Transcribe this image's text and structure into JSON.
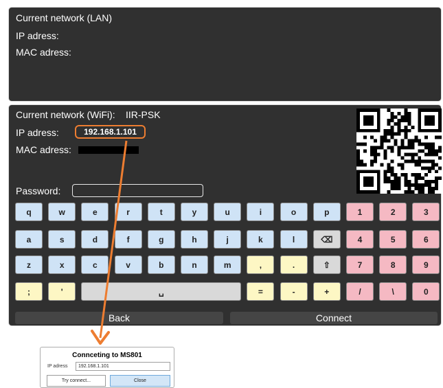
{
  "lan": {
    "title": "Current network (LAN)",
    "ip_label": "IP adress:",
    "mac_label": "MAC adress:"
  },
  "wifi": {
    "title": "Current network (WiFi):",
    "ssid": "IIR-PSK",
    "ip_label": "IP adress:",
    "ip_value": "192.168.1.101",
    "mac_label": "MAC adress:",
    "password_label": "Password:",
    "password_value": ""
  },
  "keyboard": {
    "rows": [
      [
        {
          "label": "q",
          "color": "blue"
        },
        {
          "label": "w",
          "color": "blue"
        },
        {
          "label": "e",
          "color": "blue"
        },
        {
          "label": "r",
          "color": "blue"
        },
        {
          "label": "t",
          "color": "blue"
        },
        {
          "label": "y",
          "color": "blue"
        },
        {
          "label": "u",
          "color": "blue"
        },
        {
          "label": "i",
          "color": "blue"
        },
        {
          "label": "o",
          "color": "blue"
        },
        {
          "label": "p",
          "color": "blue"
        },
        {
          "label": "1",
          "color": "red"
        },
        {
          "label": "2",
          "color": "red"
        },
        {
          "label": "3",
          "color": "red"
        }
      ],
      [
        {
          "label": "a",
          "color": "blue"
        },
        {
          "label": "s",
          "color": "blue"
        },
        {
          "label": "d",
          "color": "blue"
        },
        {
          "label": "f",
          "color": "blue"
        },
        {
          "label": "g",
          "color": "blue"
        },
        {
          "label": "h",
          "color": "blue"
        },
        {
          "label": "j",
          "color": "blue"
        },
        {
          "label": "k",
          "color": "blue"
        },
        {
          "label": "l",
          "color": "blue"
        },
        {
          "label": "⌫",
          "color": "gray",
          "name": "backspace"
        },
        {
          "label": "4",
          "color": "red"
        },
        {
          "label": "5",
          "color": "red"
        },
        {
          "label": "6",
          "color": "red"
        }
      ],
      [
        {
          "label": "z",
          "color": "blue"
        },
        {
          "label": "x",
          "color": "blue"
        },
        {
          "label": "c",
          "color": "blue"
        },
        {
          "label": "v",
          "color": "blue"
        },
        {
          "label": "b",
          "color": "blue"
        },
        {
          "label": "n",
          "color": "blue"
        },
        {
          "label": "m",
          "color": "blue"
        },
        {
          "label": ",",
          "color": "yellow"
        },
        {
          "label": ".",
          "color": "yellow"
        },
        {
          "label": "⇧",
          "color": "gray",
          "name": "shift"
        },
        {
          "label": "7",
          "color": "red"
        },
        {
          "label": "8",
          "color": "red"
        },
        {
          "label": "9",
          "color": "red"
        }
      ],
      [
        {
          "label": ";",
          "color": "yellow"
        },
        {
          "label": "'",
          "color": "yellow"
        },
        {
          "label": "␣",
          "color": "gray",
          "span": 5,
          "name": "space"
        },
        {
          "label": "=",
          "color": "yellow"
        },
        {
          "label": "-",
          "color": "yellow"
        },
        {
          "label": "+",
          "color": "yellow"
        },
        {
          "label": "/",
          "color": "red"
        },
        {
          "label": "\\",
          "color": "red"
        },
        {
          "label": "0",
          "color": "red"
        }
      ]
    ]
  },
  "buttons": {
    "back": "Back",
    "connect": "Connect"
  },
  "dialog": {
    "title": "Connceting to MS801",
    "ip_label": "IP adress",
    "ip_value": "192.168.1.101",
    "try_label": "Try connect...",
    "close_label": "Close"
  },
  "colors": {
    "panel_bg": "#303030",
    "highlight": "#ed7d31",
    "key_blue": "#cfe3f6",
    "key_yellow": "#fdf7c4",
    "key_red": "#f5b9c3",
    "key_gray": "#d9d9d9"
  }
}
